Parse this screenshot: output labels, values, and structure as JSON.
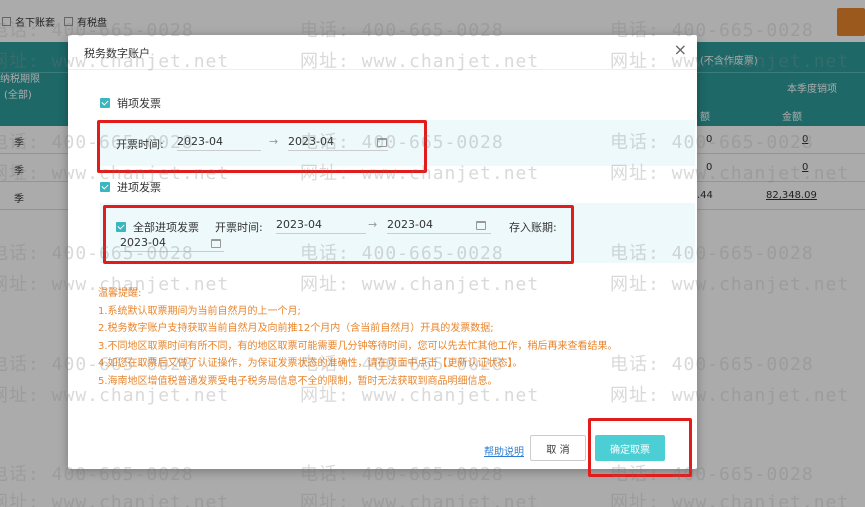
{
  "background": {
    "toolbar": {
      "checkbox1_label": "名下账套",
      "checkbox2_label": "有税盘"
    },
    "header": {
      "col_period": "纳税期限",
      "col_period_sub": "(全部)",
      "col_tax": "(不含作废票)",
      "col_season_sales": "本季度销项",
      "col_amount_short": "额",
      "col_amount": "金额"
    },
    "rows": [
      {
        "period": "季",
        "v1": "0",
        "v2": "0"
      },
      {
        "period": "季",
        "v1": "0",
        "v2": "0"
      },
      {
        "period": "季",
        "v1": ".44",
        "v2": "82,348.09"
      }
    ]
  },
  "watermark": {
    "phone": "电话: 400-665-0028",
    "site": "网址: www.chanjet.net"
  },
  "dialog": {
    "title": "税务数字账户",
    "close": "×",
    "sales": {
      "label": "销项发票",
      "time_label": "开票时间:",
      "start": "2023-04",
      "arrow": "→",
      "end": "2023-04"
    },
    "purchase": {
      "label": "进项发票",
      "all_label": "全部进项发票",
      "time_label": "开票时间:",
      "start": "2023-04",
      "arrow": "→",
      "end": "2023-04",
      "store_label": "存入账期:",
      "store_value": "2023-04"
    },
    "tips": {
      "title": "温馨提醒:",
      "items": [
        "1.系统默认取票期间为当前自然月的上一个月;",
        "2.税务数字账户支持获取当前自然月及向前推12个月内（含当前自然月）开具的发票数据;",
        "3.不同地区取票时间有所不同，有的地区取票可能需要几分钟等待时间，您可以先去忙其他工作，稍后再来查看结果。",
        "4.如您在取票后又做了认证操作，为保证发票状态的准确性，请在页面中点击【更新认证状态】。",
        "5.海南地区增值税普通发票受电子税务局信息不全的限制，暂时无法获取到商品明细信息。"
      ]
    },
    "help_link": "帮助说明",
    "cancel": "取 消",
    "confirm": "确定取票"
  },
  "colors": {
    "accent": "#3ab6c0",
    "header_teal": "#2e9c9c",
    "tips_orange": "#e8852e",
    "highlight_red": "#e21b1b"
  }
}
